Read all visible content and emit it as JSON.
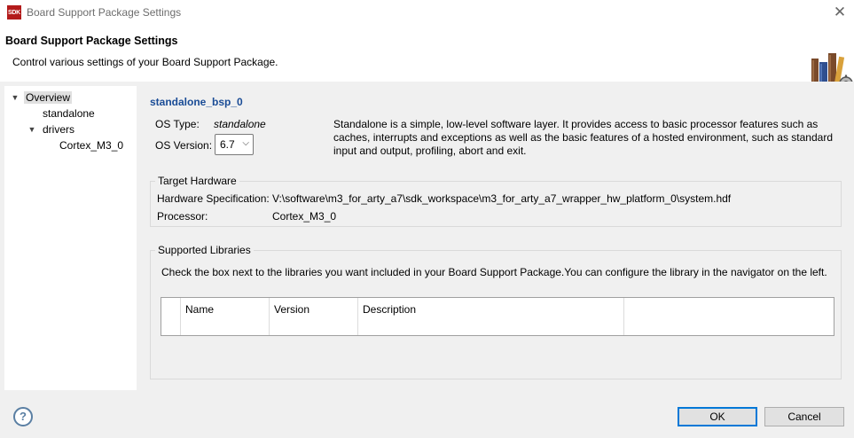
{
  "window": {
    "app_icon_text": "SDK",
    "title": "Board Support Package Settings",
    "close_glyph": "✕"
  },
  "header": {
    "title": "Board Support Package Settings",
    "description": "Control various settings of your Board Support Package.",
    "graphic_icon": "books-gear-icon"
  },
  "tree": {
    "items": [
      {
        "label": "Overview",
        "expanded": true,
        "selected": true
      },
      {
        "label": "standalone"
      },
      {
        "label": "drivers",
        "expanded": true
      },
      {
        "label": "Cortex_M3_0"
      }
    ]
  },
  "overview": {
    "bsp_name": "standalone_bsp_0",
    "os_type_label": "OS Type:",
    "os_type_value": "standalone",
    "os_version_label": "OS Version:",
    "os_version_value": "6.7",
    "os_description": "Standalone is a simple, low-level software layer. It provides access to basic processor features such as caches, interrupts and exceptions as well as the basic features of a hosted environment, such as standard input and output, profiling, abort and exit."
  },
  "target_hardware": {
    "title": "Target Hardware",
    "hw_spec_label": "Hardware Specification:",
    "hw_spec_value": "V:\\software\\m3_for_arty_a7\\sdk_workspace\\m3_for_arty_a7_wrapper_hw_platform_0\\system.hdf",
    "processor_label": "Processor:",
    "processor_value": "Cortex_M3_0"
  },
  "libraries": {
    "title": "Supported Libraries",
    "instructions": "Check the box next to the libraries you want included in your Board Support Package.You can configure the library in the navigator on the left.",
    "columns": [
      "",
      "Name",
      "Version",
      "Description"
    ]
  },
  "buttons": {
    "help_glyph": "?",
    "ok": "OK",
    "cancel": "Cancel"
  },
  "colors": {
    "accent": "#0078d7",
    "bsp_name": "#1a4c96",
    "app_icon": "#b31b1b"
  }
}
